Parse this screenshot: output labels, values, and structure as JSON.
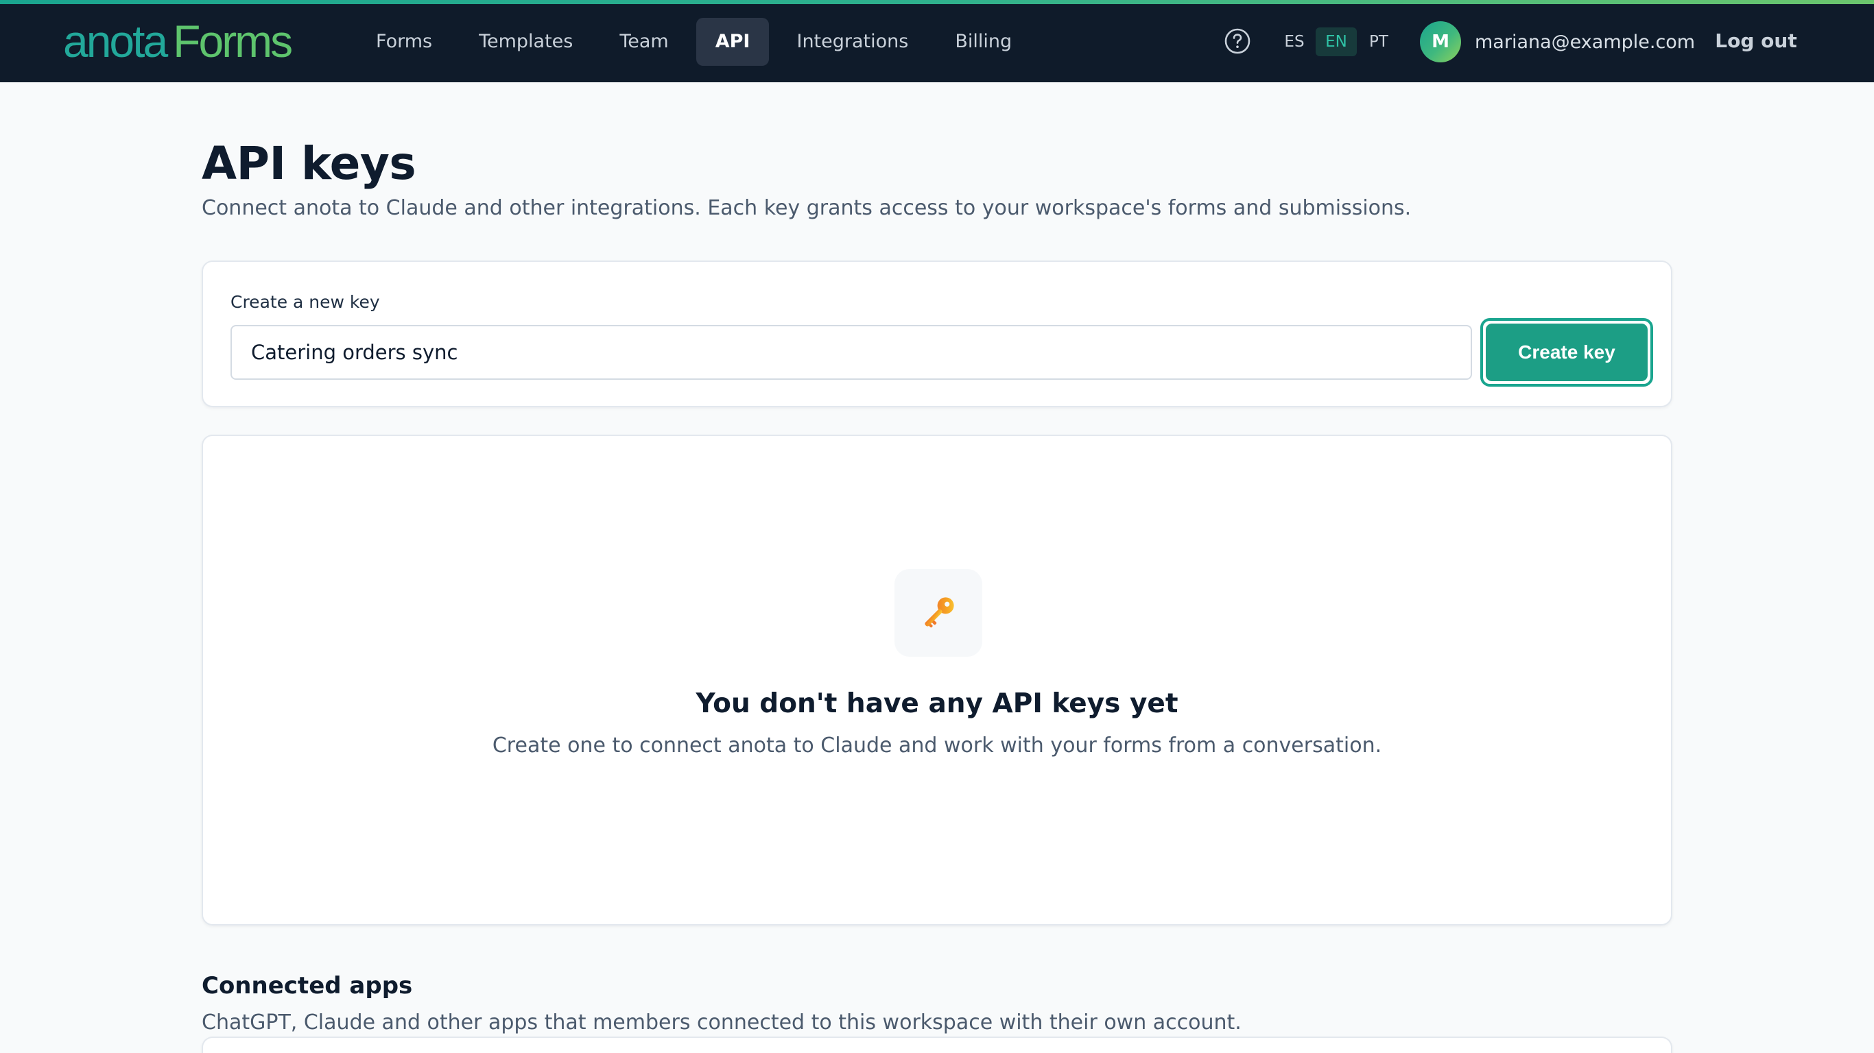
{
  "header": {
    "logo_brand": "anota",
    "logo_product": "Forms",
    "nav": [
      {
        "label": "Forms",
        "active": false
      },
      {
        "label": "Templates",
        "active": false
      },
      {
        "label": "Team",
        "active": false
      },
      {
        "label": "API",
        "active": true
      },
      {
        "label": "Integrations",
        "active": false
      },
      {
        "label": "Billing",
        "active": false
      }
    ],
    "help_icon": "question-circle-icon",
    "languages": [
      "ES",
      "EN",
      "PT"
    ],
    "selected_language": "EN",
    "avatar_initial": "M",
    "user_email": "mariana@example.com",
    "logout_label": "Log out"
  },
  "page": {
    "title": "API keys",
    "subtitle": "Connect anota to Claude and other integrations. Each key grants access to your workspace's forms and submissions."
  },
  "create_key": {
    "label": "Create a new key",
    "input_value": "Catering orders sync",
    "button_label": "Create key"
  },
  "empty_state": {
    "icon": "key-icon",
    "title": "You don't have any API keys yet",
    "description": "Create one to connect anota to Claude and work with your forms from a conversation."
  },
  "connected_apps": {
    "title": "Connected apps",
    "description": "ChatGPT, Claude and other apps that members connected to this workspace with their own account."
  },
  "colors": {
    "topbar_bg": "#0f1b2a",
    "accent": "#1c9e85",
    "logo_brand": "#22a89a",
    "logo_product": "#5ec46d"
  }
}
